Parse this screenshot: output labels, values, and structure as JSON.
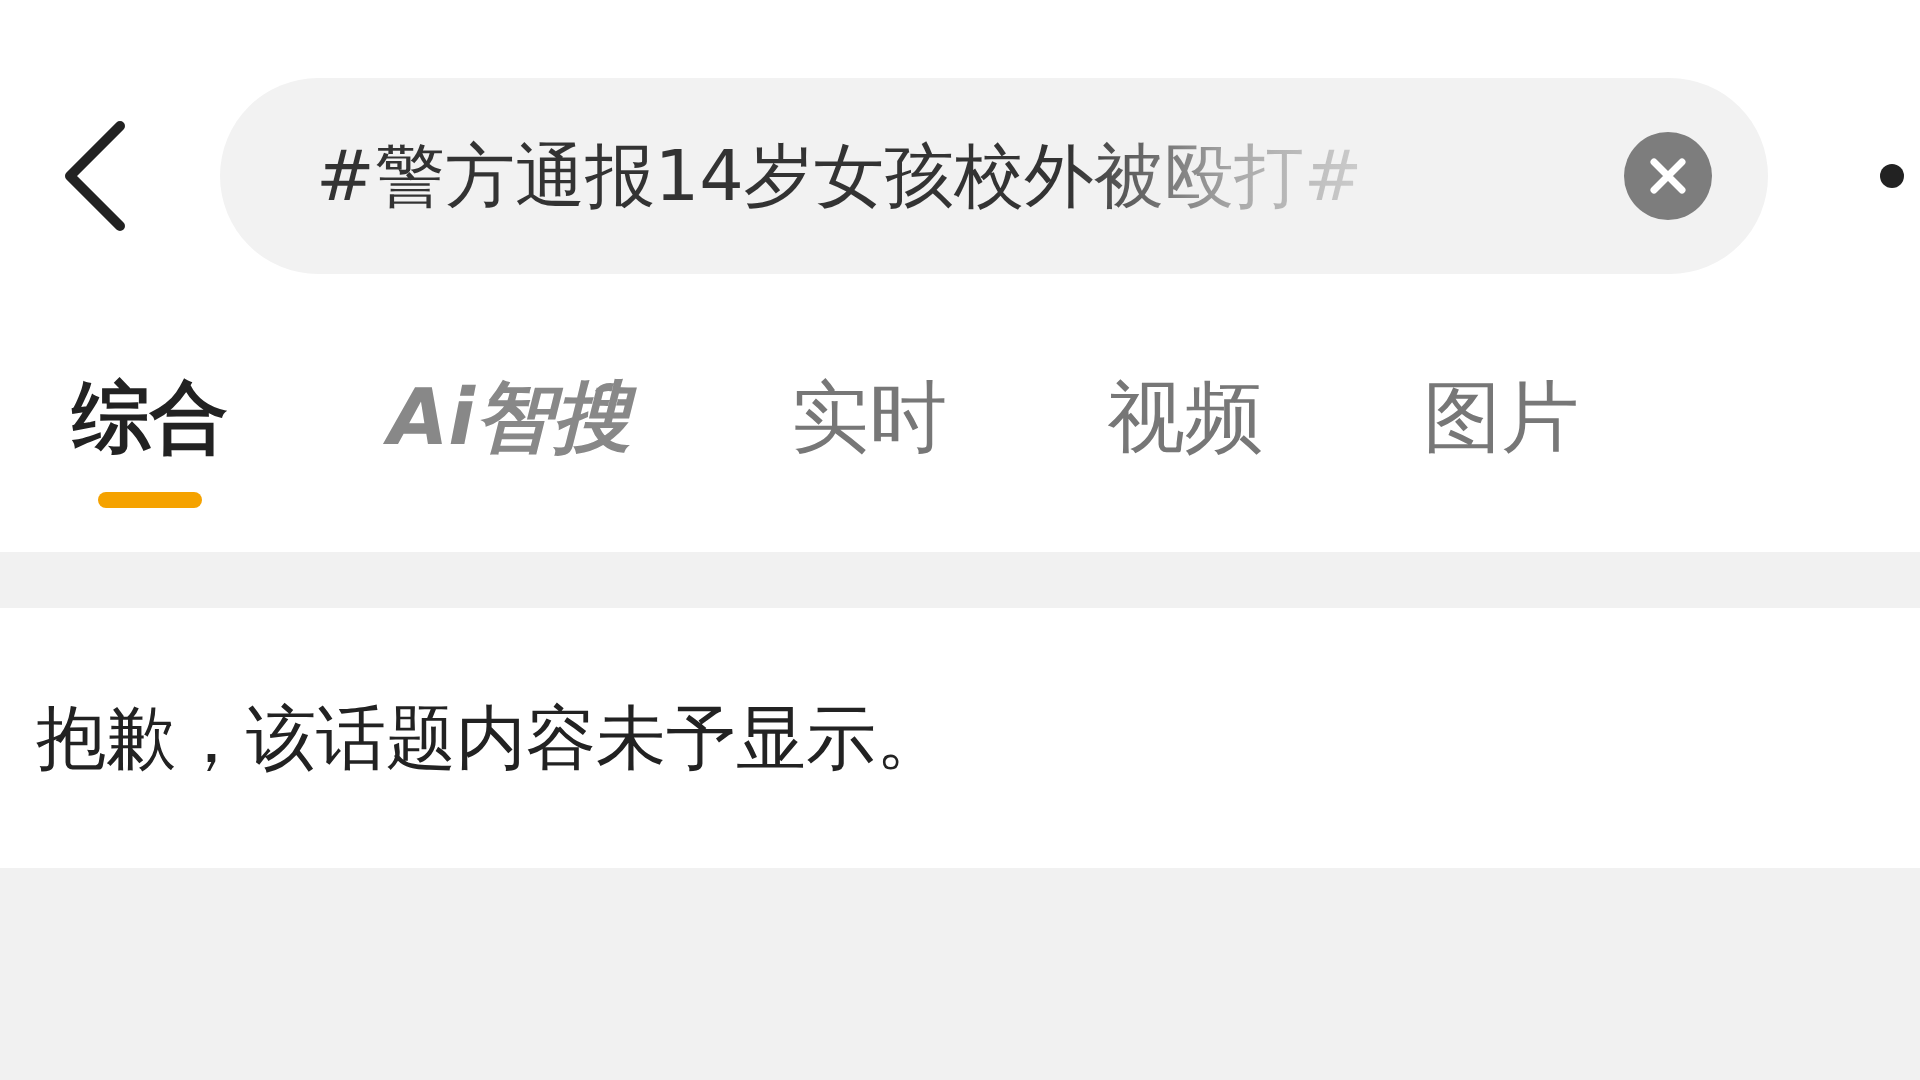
{
  "search": {
    "value": "#警方通报14岁女孩校外被殴打#"
  },
  "tabs": [
    {
      "label": "综合",
      "selected": true,
      "kind": "text"
    },
    {
      "label": "Ai智搜",
      "selected": false,
      "kind": "ai"
    },
    {
      "label": "实时",
      "selected": false,
      "kind": "text"
    },
    {
      "label": "视频",
      "selected": false,
      "kind": "text"
    },
    {
      "label": "图片",
      "selected": false,
      "kind": "text"
    }
  ],
  "message": "抱歉，该话题内容未予显示。"
}
